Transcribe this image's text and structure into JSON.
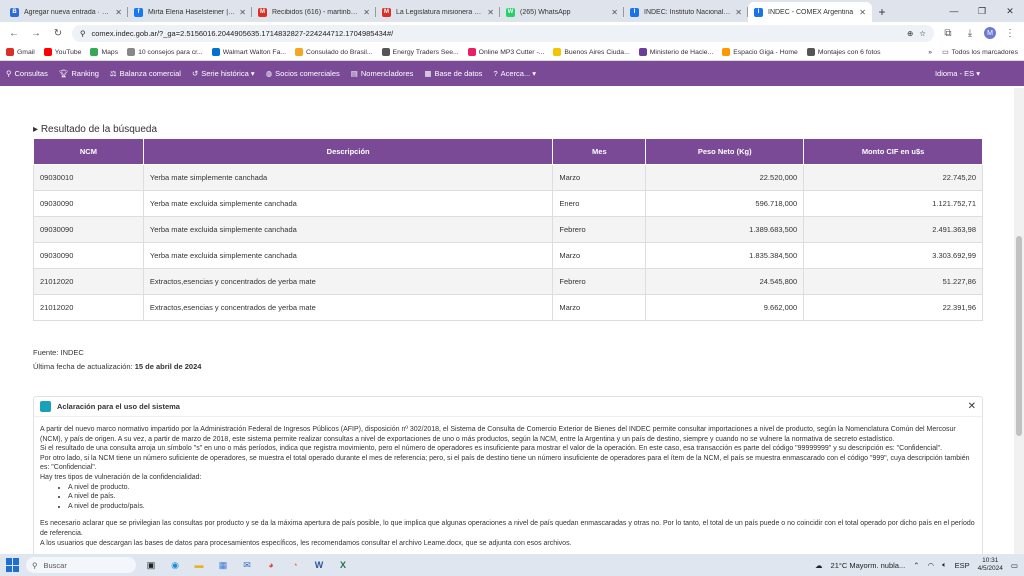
{
  "browser": {
    "tabs": [
      {
        "label": "Agregar nueva entrada · Plan B",
        "icon": "B",
        "color": "#2d6bd7"
      },
      {
        "label": "Mirta Elena Haselsteiner | Faceb",
        "icon": "f",
        "color": "#1877f2"
      },
      {
        "label": "Recibidos (616) - martinboern20",
        "icon": "M",
        "color": "#d93025"
      },
      {
        "label": "La Legislatura misionera declar",
        "icon": "M",
        "color": "#d93025"
      },
      {
        "label": "(265) WhatsApp",
        "icon": "W",
        "color": "#25d366"
      },
      {
        "label": "INDEC: Instituto Nacional de Est",
        "icon": "I",
        "color": "#1a73e8"
      },
      {
        "label": "INDEC - COMEX Argentina",
        "icon": "I",
        "color": "#1a73e8",
        "active": true
      }
    ],
    "url": "comex.indec.gob.ar/?_ga=2.5156016.2044905635.1714832827-224244712.1704985434#/",
    "avatar": "M",
    "bookmarks": [
      {
        "label": "Gmail",
        "color": "#d93025"
      },
      {
        "label": "YouTube",
        "color": "#ff0000"
      },
      {
        "label": "Maps",
        "color": "#34a853"
      },
      {
        "label": "10 consejos para cr...",
        "color": "#888"
      },
      {
        "label": "Walmart Walton Fa...",
        "color": "#0071ce"
      },
      {
        "label": "Consulado do Brasil...",
        "color": "#f5a623"
      },
      {
        "label": "Energy Traders See...",
        "color": "#555"
      },
      {
        "label": "Online MP3 Cutter -...",
        "color": "#e91e63"
      },
      {
        "label": "Buenos Aires Ciuda...",
        "color": "#f5c400"
      },
      {
        "label": "Ministerio de Hacie...",
        "color": "#6a3d9a"
      },
      {
        "label": "Espacio Giga - Home",
        "color": "#ff9800"
      },
      {
        "label": "Montajes con 6 fotos",
        "color": "#555"
      }
    ],
    "all_bookmarks": "Todos los marcadores"
  },
  "nav": {
    "items": [
      "Consultas",
      "Ranking",
      "Balanza comercial",
      "Serie histórica ▾",
      "Socios comerciales",
      "Nomencladores",
      "Base de datos",
      "Acerca... ▾"
    ],
    "language": "Idioma - ES ▾"
  },
  "results": {
    "title": "Resultado de la búsqueda",
    "columns": [
      "NCM",
      "Descripción",
      "Mes",
      "Peso Neto (Kg)",
      "Monto CIF en u$s"
    ],
    "rows": [
      [
        "09030010",
        "Yerba mate simplemente canchada",
        "Marzo",
        "22.520,000",
        "22.745,20"
      ],
      [
        "09030090",
        "Yerba mate excluida simplemente canchada",
        "Enero",
        "596.718,000",
        "1.121.752,71"
      ],
      [
        "09030090",
        "Yerba mate excluida simplemente canchada",
        "Febrero",
        "1.389.683,500",
        "2.491.363,98"
      ],
      [
        "09030090",
        "Yerba mate excluida simplemente canchada",
        "Marzo",
        "1.835.384,500",
        "3.303.692,99"
      ],
      [
        "21012020",
        "Extractos,esencias y concentrados de yerba mate",
        "Febrero",
        "24.545,800",
        "51.227,86"
      ],
      [
        "21012020",
        "Extractos,esencias y concentrados de yerba mate",
        "Marzo",
        "9.662,000",
        "22.391,96"
      ]
    ],
    "fuente": "Fuente: INDEC",
    "ultima_label": "Última fecha de actualización: ",
    "ultima_value": "15 de abril de 2024"
  },
  "notice": {
    "title": "Aclaración para el uso del sistema",
    "p1": "A partir del nuevo marco normativo impartido por la Administración Federal de Ingresos Públicos (AFIP), disposición nº 302/2018, el Sistema de Consulta de Comercio Exterior de Bienes del INDEC permite consultar importaciones a nivel de producto, según la Nomenclatura Común del Mercosur (NCM), y país de origen. A su vez, a partir de marzo de 2018, este sistema permite realizar consultas a nivel de exportaciones de uno o más productos, según la NCM, entre la Argentina y un país de destino, siempre y cuando no se vulnere la normativa de secreto estadístico.",
    "p2": "Si el resultado de una consulta arroja un símbolo \"s\" en uno o más períodos, indica que registra movimiento, pero el número de operadores es insuficiente para mostrar el valor de la operación. En este caso, esa transacción es parte del código \"99999999\" y su descripción es: \"Confidencial\".",
    "p3": "Por otro lado, si la NCM tiene un número suficiente de operadores, se muestra el total operado durante el mes de referencia; pero, si el país de destino tiene un número insuficiente de operadores para el ítem de la NCM, el país se muestra enmascarado con el código \"999\", cuya descripción también es: \"Confidencial\".",
    "p4": "Hay tres tipos de vulneración de la confidencialidad:",
    "list": [
      "A nivel de producto.",
      "A nivel de país.",
      "A nivel de producto/país."
    ],
    "p5": "Es necesario aclarar que se privilegian las consultas por producto y se da la máxima apertura de país posible, lo que implica que algunas operaciones a nivel de país quedan enmascaradas y otras no. Por lo tanto, el total de un país puede o no coincidir con el total operado por dicho país en el período de referencia.",
    "p6": "A los usuarios que descargan las bases de datos para procesamientos específicos, les recomendamos consultar el archivo Leame.docx, que se adjunta con esos archivos."
  },
  "taskbar": {
    "search": "Buscar",
    "weather": "21°C  Mayorm. nubla...",
    "lang": "ESP",
    "time": "10:31",
    "date": "4/5/2024"
  }
}
